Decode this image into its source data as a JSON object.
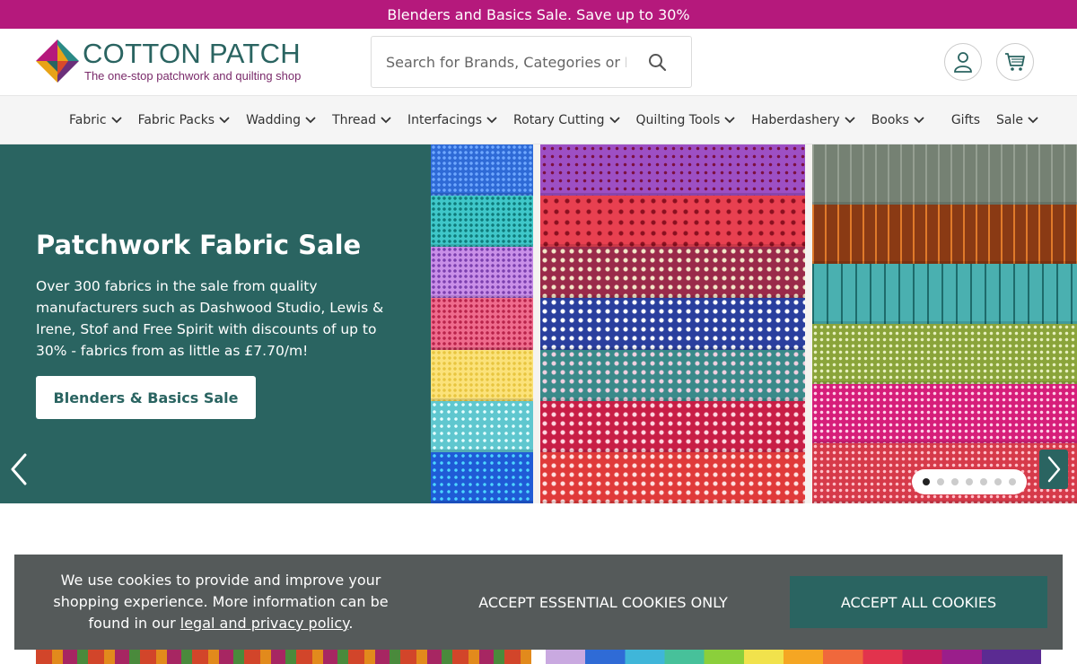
{
  "promo_bar": {
    "text": "Blenders and Basics Sale. Save up to 30%",
    "color": "#b5197c"
  },
  "header": {
    "logo": {
      "title": "COTTON PATCH",
      "tagline": "The one-stop patchwork and quilting shop"
    },
    "search": {
      "placeholder": "Search for Brands, Categories or Products",
      "icon": "search-icon"
    },
    "account_icon": "user-icon",
    "cart_icon": "cart-icon"
  },
  "nav": {
    "items": [
      {
        "label": "Fabric",
        "has_dropdown": true
      },
      {
        "label": "Fabric Packs",
        "has_dropdown": true
      },
      {
        "label": "Wadding",
        "has_dropdown": true
      },
      {
        "label": "Thread",
        "has_dropdown": true
      },
      {
        "label": "Interfacings",
        "has_dropdown": true
      },
      {
        "label": "Rotary Cutting",
        "has_dropdown": true
      },
      {
        "label": "Quilting Tools",
        "has_dropdown": true
      },
      {
        "label": "Haberdashery",
        "has_dropdown": true
      },
      {
        "label": "Books",
        "has_dropdown": true
      },
      {
        "label": "Gifts",
        "has_dropdown": false
      },
      {
        "label": "Sale",
        "has_dropdown": true
      }
    ]
  },
  "hero": {
    "title": "Patchwork Fabric Sale",
    "text": "Over 300 fabrics in the sale from quality manufacturers such as Dashwood Studio, Lewis & Irene, Stof and Free Spirit with discounts of up to 30% - fabrics from as little as £7.70/m!",
    "cta_label": "Blenders & Basics Sale",
    "slide_count": 7,
    "active_slide": 1,
    "accent_color": "#2a6461"
  },
  "cookie_banner": {
    "text_before_link": "We use cookies to provide and improve your shopping experience. More information can be found in our ",
    "link_text": "legal and privacy policy",
    "text_after_link": ".",
    "essential_label": "ACCEPT ESSENTIAL COOKIES ONLY",
    "accept_all_label": "ACCEPT ALL COOKIES"
  }
}
